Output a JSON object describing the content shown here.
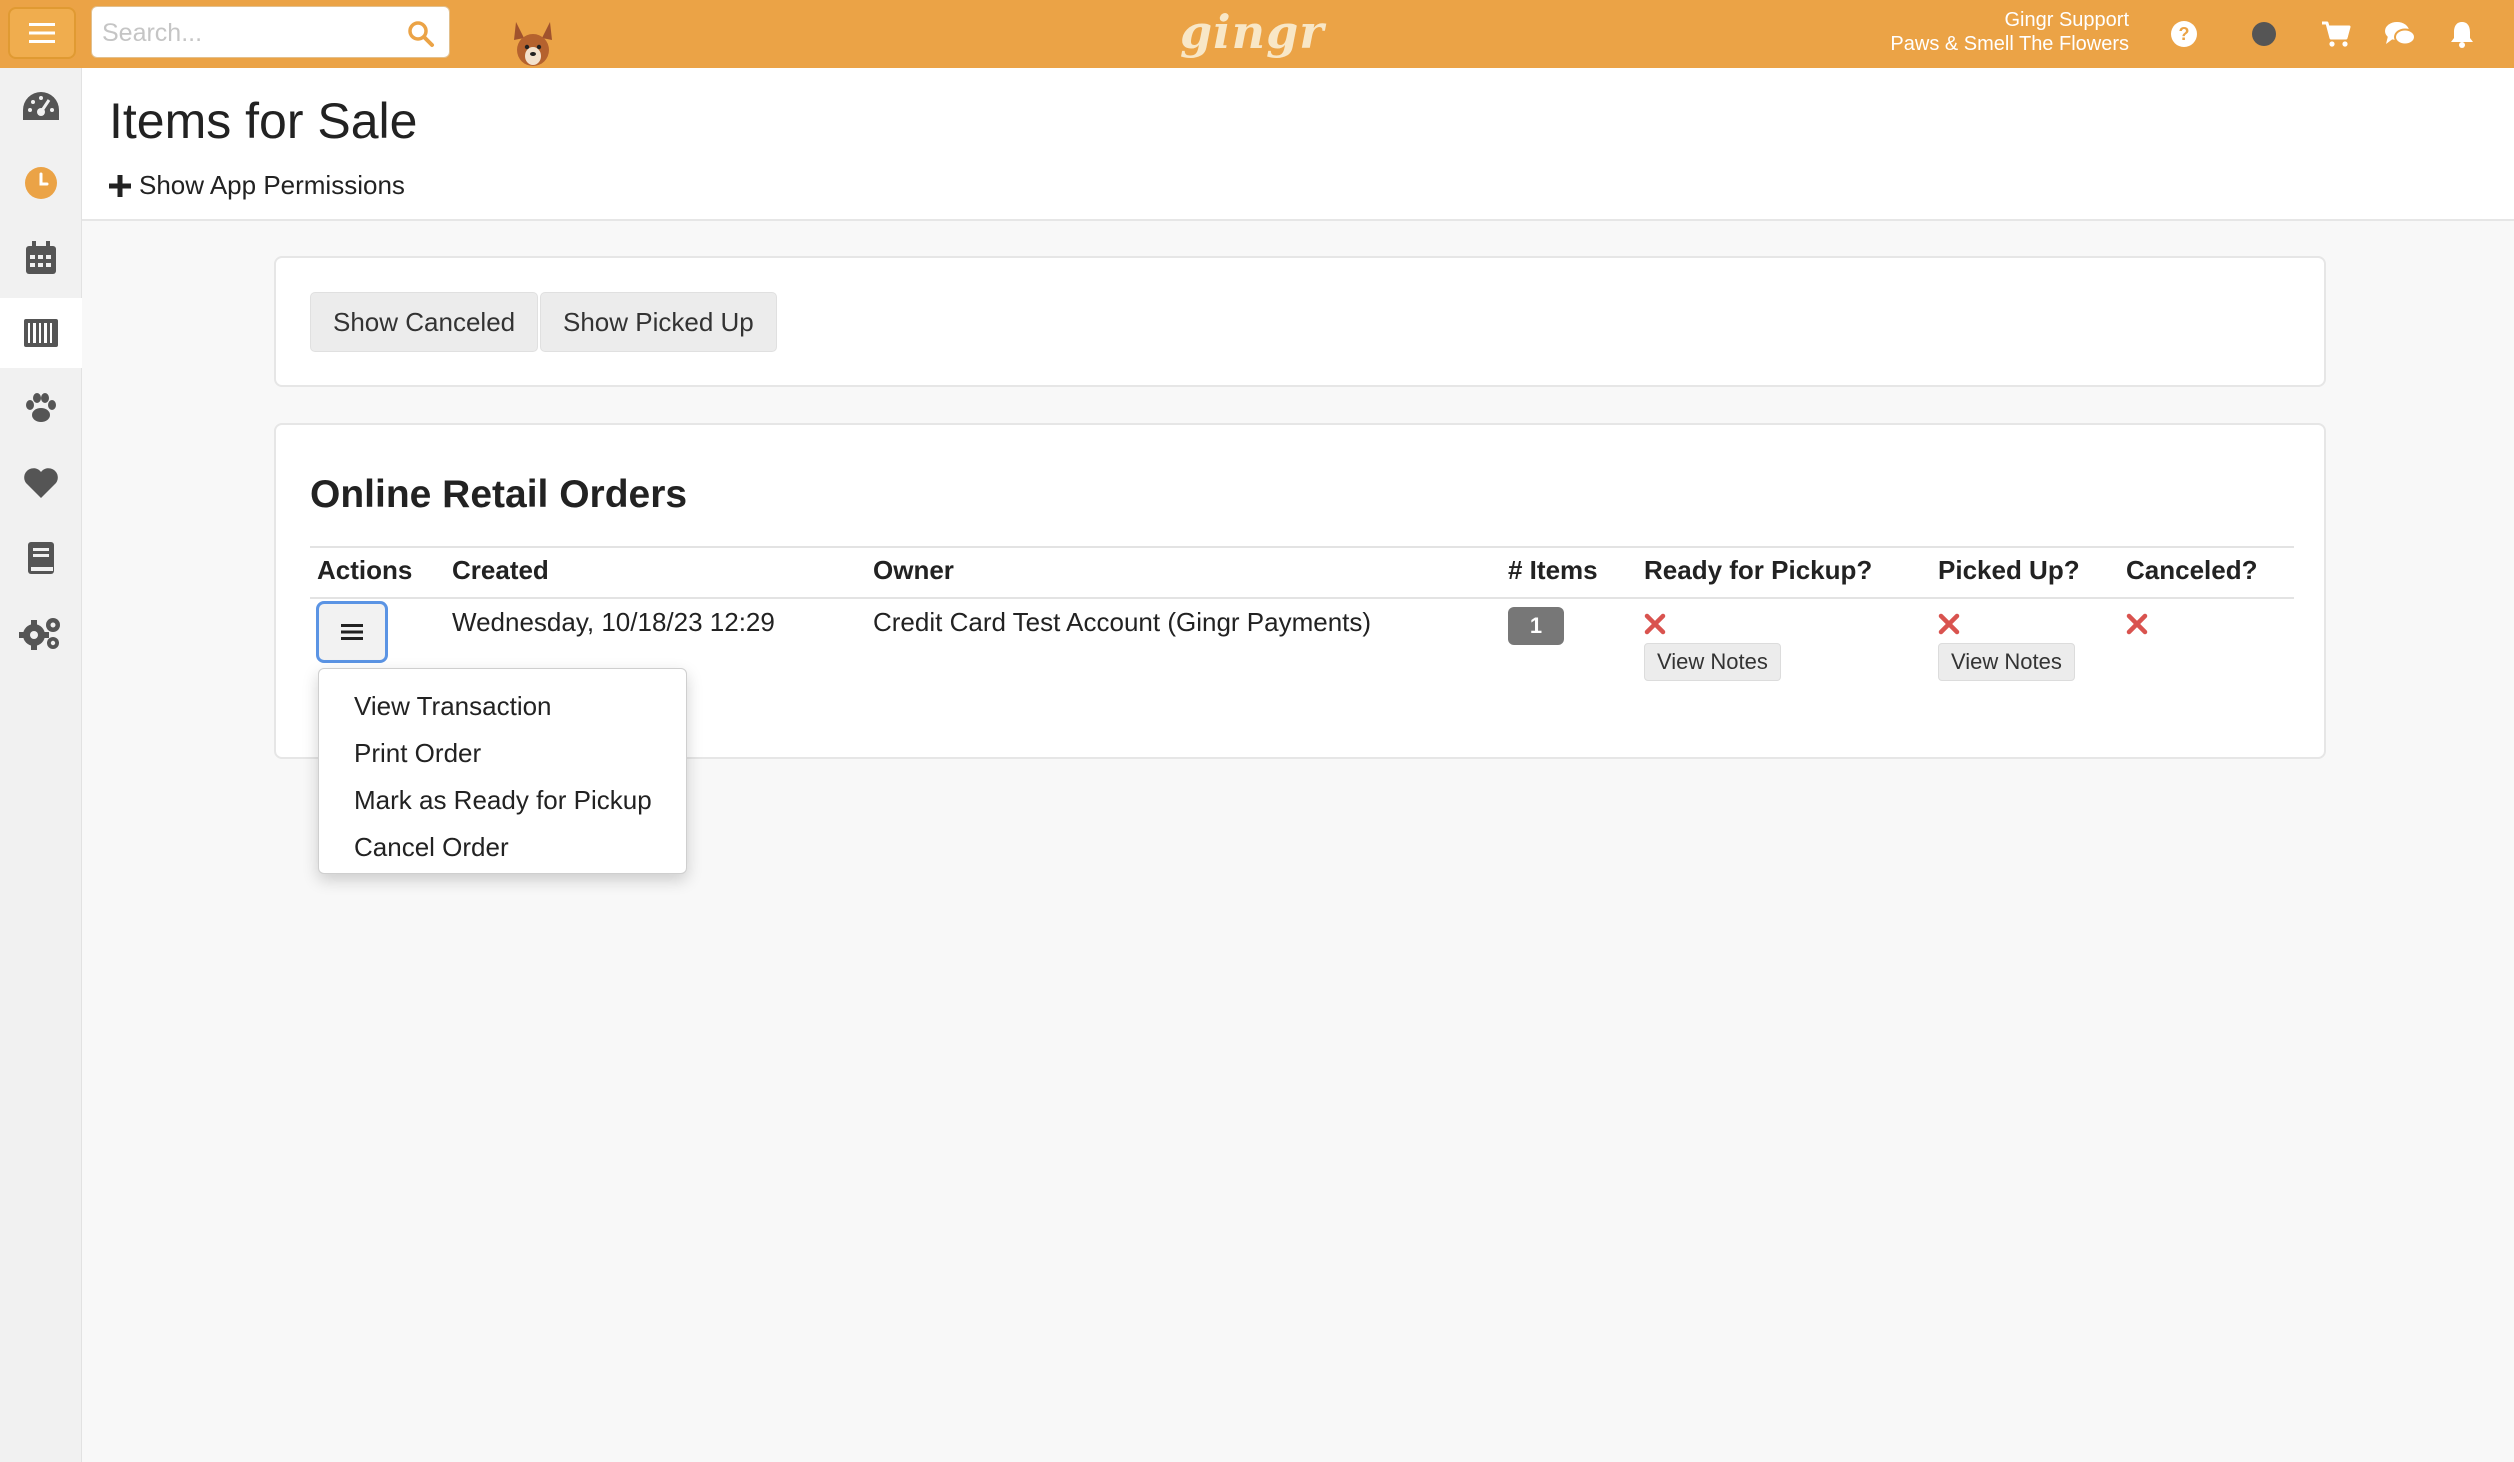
{
  "topbar": {
    "search_placeholder": "Search...",
    "logo_text": "gingr",
    "user_name": "Gingr Support",
    "business_name": "Paws & Smell The Flowers",
    "icons": [
      "help-icon",
      "status-dot-icon",
      "cart-icon",
      "chat-icon",
      "bell-icon"
    ],
    "accent_color": "#eba346"
  },
  "sidebar": {
    "items": [
      {
        "name": "dashboard-icon"
      },
      {
        "name": "clock-icon"
      },
      {
        "name": "calendar-icon"
      },
      {
        "name": "barcode-icon"
      },
      {
        "name": "paw-icon"
      },
      {
        "name": "heart-icon"
      },
      {
        "name": "book-icon"
      },
      {
        "name": "settings-icon"
      }
    ]
  },
  "page": {
    "title": "Items for Sale",
    "permissions_link": "Show App Permissions"
  },
  "filters": {
    "show_canceled": "Show Canceled",
    "show_picked_up": "Show Picked Up"
  },
  "orders": {
    "title": "Online Retail Orders",
    "columns": [
      "Actions",
      "Created",
      "Owner",
      "# Items",
      "Ready for Pickup?",
      "Picked Up?",
      "Canceled?"
    ],
    "rows": [
      {
        "created": "Wednesday, 10/18/23 12:29",
        "owner": "Credit Card Test Account (Gingr Payments)",
        "items": "1",
        "view_notes": "View Notes"
      }
    ]
  },
  "action_menu": {
    "items": [
      "View Transaction",
      "Print Order",
      "Mark as Ready for Pickup",
      "Cancel Order"
    ]
  }
}
